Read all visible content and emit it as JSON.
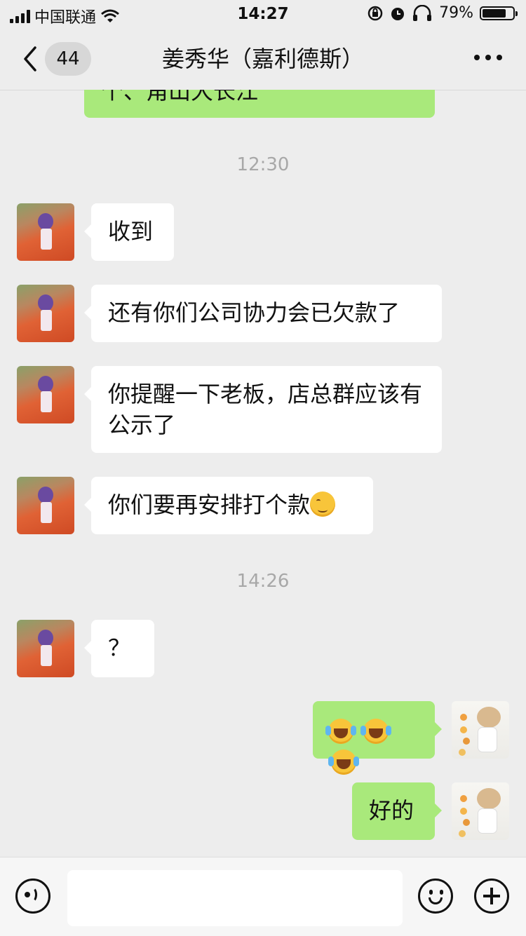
{
  "status_bar": {
    "carrier": "中国联通",
    "time": "14:27",
    "battery": "79%",
    "battery_level": 0.79,
    "icons": [
      "signal-icon",
      "wifi-icon",
      "orientation-lock-icon",
      "alarm-icon",
      "headphones-icon",
      "battery-icon"
    ]
  },
  "nav": {
    "unread_count": "44",
    "title": "姜秀华（嘉利德斯）",
    "icons": [
      "back-icon",
      "more-icon"
    ]
  },
  "messages": [
    {
      "type": "out",
      "text": "个、角山大长江",
      "partially_visible": true
    },
    {
      "type": "time",
      "text": "12:30"
    },
    {
      "type": "in",
      "text": "收到"
    },
    {
      "type": "in",
      "text": "还有你们公司协力会已欠款了"
    },
    {
      "type": "in",
      "text": "你提醒一下老板，店总群应该有公示了"
    },
    {
      "type": "in",
      "text": "你们要再安排打个款",
      "emoji": "smiling-blush-emoji"
    },
    {
      "type": "time",
      "text": "14:26"
    },
    {
      "type": "in",
      "text": "？"
    },
    {
      "type": "out",
      "text": "",
      "emoji": "rolling-on-floor-laughing-emoji x3"
    },
    {
      "type": "out",
      "text": "好的"
    }
  ],
  "input_bar": {
    "input_value": "",
    "icons": [
      "voice-icon",
      "emoji-icon",
      "add-icon"
    ]
  },
  "colors": {
    "background": "#ededed",
    "incoming_bubble": "#ffffff",
    "outgoing_bubble": "#a9e97b",
    "timestamp": "#a8a8a8"
  }
}
